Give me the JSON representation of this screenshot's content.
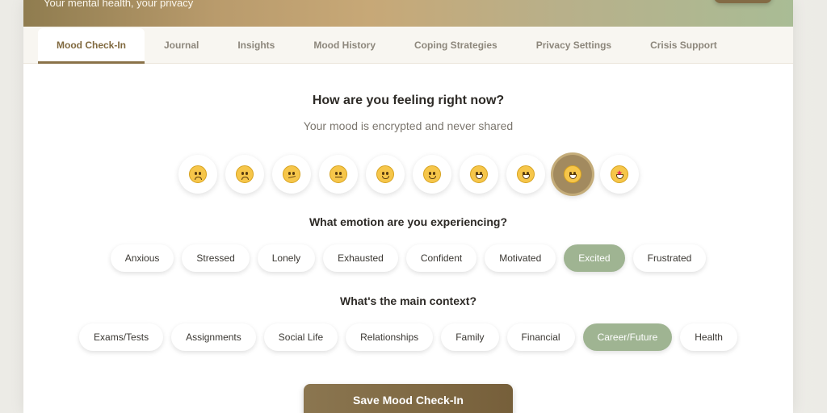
{
  "header": {
    "tagline": "Your mental health, your privacy"
  },
  "tabs": [
    {
      "label": "Mood Check-In",
      "active": true
    },
    {
      "label": "Journal"
    },
    {
      "label": "Insights"
    },
    {
      "label": "Mood History"
    },
    {
      "label": "Coping Strategies"
    },
    {
      "label": "Privacy Settings"
    },
    {
      "label": "Crisis Support"
    }
  ],
  "main": {
    "question": "How are you feeling right now?",
    "subtitle": "Your mood is encrypted and never shared",
    "mood_scale": {
      "count": 10,
      "selected_index": 8,
      "icons": [
        "pensive-face-icon",
        "worried-face-icon",
        "confused-face-icon",
        "neutral-face-icon",
        "slightly-smiling-face-icon",
        "smiling-face-icon",
        "grinning-face-icon",
        "beaming-face-icon",
        "grimacing-face-icon",
        "star-struck-face-icon"
      ]
    },
    "emotion_title": "What emotion are you experiencing?",
    "emotions": [
      "Anxious",
      "Stressed",
      "Lonely",
      "Exhausted",
      "Confident",
      "Motivated",
      "Excited",
      "Frustrated"
    ],
    "emotion_selected": "Excited",
    "context_title": "What's the main context?",
    "contexts": [
      "Exams/Tests",
      "Assignments",
      "Social Life",
      "Relationships",
      "Family",
      "Financial",
      "Career/Future",
      "Health"
    ],
    "context_selected": "Career/Future",
    "save_label": "Save Mood Check-In"
  },
  "colors": {
    "accent": "#8a7248",
    "chip_selected": "#9fb492",
    "mood_selected": "#a28a5f"
  }
}
